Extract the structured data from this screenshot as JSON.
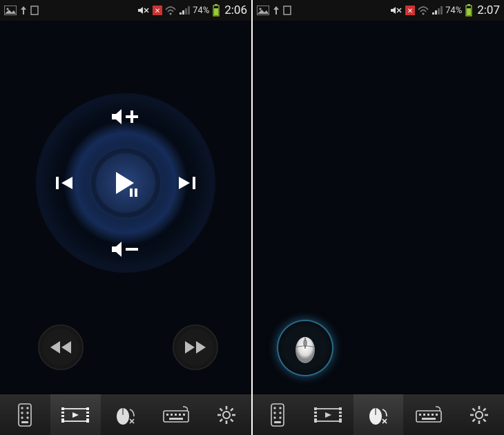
{
  "left": {
    "status": {
      "battery": "74%",
      "time": "2:06"
    },
    "tabs": [
      "remote",
      "media",
      "mouse",
      "keyboard",
      "settings"
    ],
    "active_tab": "media",
    "media": {
      "center": "play-pause",
      "north": "volume-up",
      "south": "volume-down",
      "west": "previous-track",
      "east": "next-track"
    },
    "extras": {
      "rewind": "rewind",
      "fastfwd": "fast-forward"
    }
  },
  "right": {
    "status": {
      "battery": "74%",
      "time": "2:07"
    },
    "tabs": [
      "remote",
      "media",
      "mouse",
      "keyboard",
      "settings"
    ],
    "active_tab": "mouse",
    "mouse_button": "mouse"
  }
}
